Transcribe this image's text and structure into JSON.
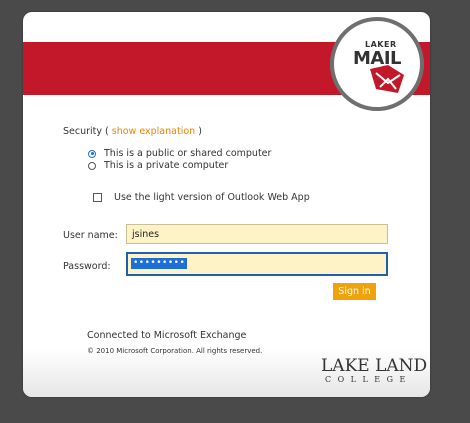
{
  "logo": {
    "line1": "LAKER",
    "line2": "MAIL"
  },
  "security": {
    "prefix": "Security ( ",
    "link": "show explanation",
    "suffix": " )",
    "options": [
      {
        "label": "This is a public or shared computer",
        "checked": true
      },
      {
        "label": "This is a private computer",
        "checked": false
      }
    ]
  },
  "light_version": {
    "label": "Use the light version of Outlook Web App",
    "checked": false
  },
  "username": {
    "label": "User name:",
    "value": "jsines"
  },
  "password": {
    "label": "Password:",
    "mask": "•••••••••"
  },
  "signin_label": "Sign in",
  "footer": {
    "connected": "Connected to Microsoft Exchange",
    "copyright": "© 2010 Microsoft Corporation. All rights reserved."
  },
  "college": {
    "line1": "LAKE LAND",
    "line2": "COLLEGE"
  },
  "colors": {
    "brand_red": "#c3172a",
    "accent_orange": "#f08300",
    "signin_bg": "#f0a20a"
  }
}
